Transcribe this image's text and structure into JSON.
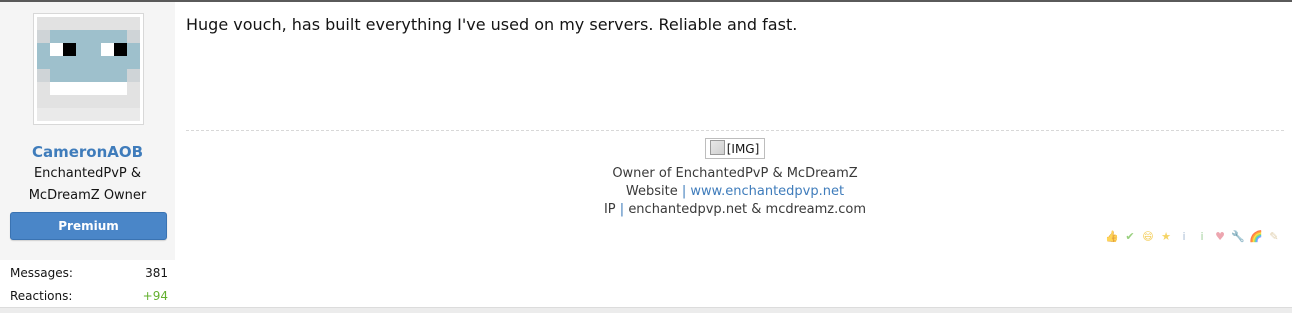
{
  "post": {
    "author": {
      "username": "CameronAOB",
      "title": "EnchantedPvP & McDreamZ Owner",
      "badge": "Premium",
      "stats": [
        {
          "label": "Messages:",
          "value": "381"
        },
        {
          "label": "Reactions:",
          "value": "+94"
        }
      ]
    },
    "content": "Huge vouch, has built everything I've used on my servers. Reliable and fast.",
    "signature": {
      "image_alt": "[IMG]",
      "line1": "Owner of EnchantedPvP & McDreamZ",
      "website_label": "Website",
      "website_url": "www.enchantedpvp.net",
      "ip_label": "IP",
      "ip_value": "enchantedpvp.net & mcdreamz.com"
    },
    "reactions": [
      {
        "name": "like-reaction-icon",
        "glyph": "👍"
      },
      {
        "name": "agree-reaction-icon",
        "glyph": "✔"
      },
      {
        "name": "funny-reaction-icon",
        "glyph": "😄"
      },
      {
        "name": "winner-reaction-icon",
        "glyph": "★"
      },
      {
        "name": "informative-reaction-icon",
        "glyph": "i"
      },
      {
        "name": "useful-reaction-icon",
        "glyph": "i"
      },
      {
        "name": "love-reaction-icon",
        "glyph": "♥"
      },
      {
        "name": "fix-reaction-icon",
        "glyph": "🔧"
      },
      {
        "name": "rainbow-reaction-icon",
        "glyph": "🌈"
      },
      {
        "name": "creative-reaction-icon",
        "glyph": "✎"
      }
    ]
  },
  "colors": {
    "link": "#3f7cbb",
    "premium_badge": "#4a86c8",
    "positive": "#63b02f"
  }
}
